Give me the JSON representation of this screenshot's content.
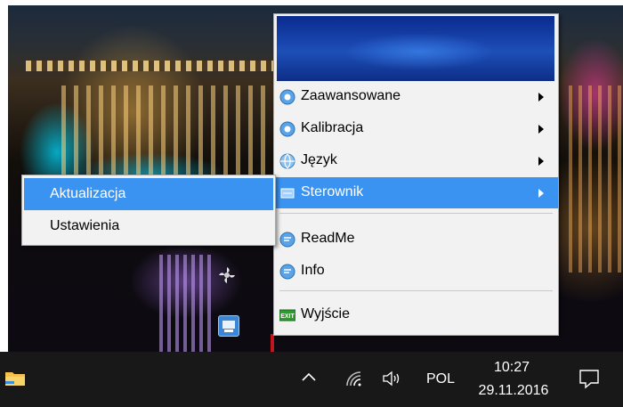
{
  "context_menu": {
    "items": [
      {
        "label": "Zaawansowane",
        "icon": "gear-globe-icon",
        "has_submenu": true
      },
      {
        "label": "Kalibracja",
        "icon": "gear-globe-icon",
        "has_submenu": true
      },
      {
        "label": "Język",
        "icon": "globe-icon",
        "has_submenu": true
      },
      {
        "label": "Sterownik",
        "icon": "driver-icon",
        "has_submenu": true,
        "highlighted": true
      },
      {
        "label": "ReadMe",
        "icon": "info-bubble-icon",
        "has_submenu": false
      },
      {
        "label": "Info",
        "icon": "info-bubble-icon",
        "has_submenu": false
      },
      {
        "label": "Wyjście",
        "icon": "exit-icon",
        "has_submenu": false
      }
    ]
  },
  "submenu": {
    "items": [
      {
        "label": "Aktualizacja",
        "highlighted": true
      },
      {
        "label": "Ustawienia",
        "highlighted": false
      }
    ]
  },
  "taskbar": {
    "language": "POL",
    "time": "10:27",
    "date": "29.11.2016"
  },
  "colors": {
    "highlight": "#3b93f1",
    "menu_bg": "#f2f2f2",
    "taskbar_bg": "#181818"
  }
}
